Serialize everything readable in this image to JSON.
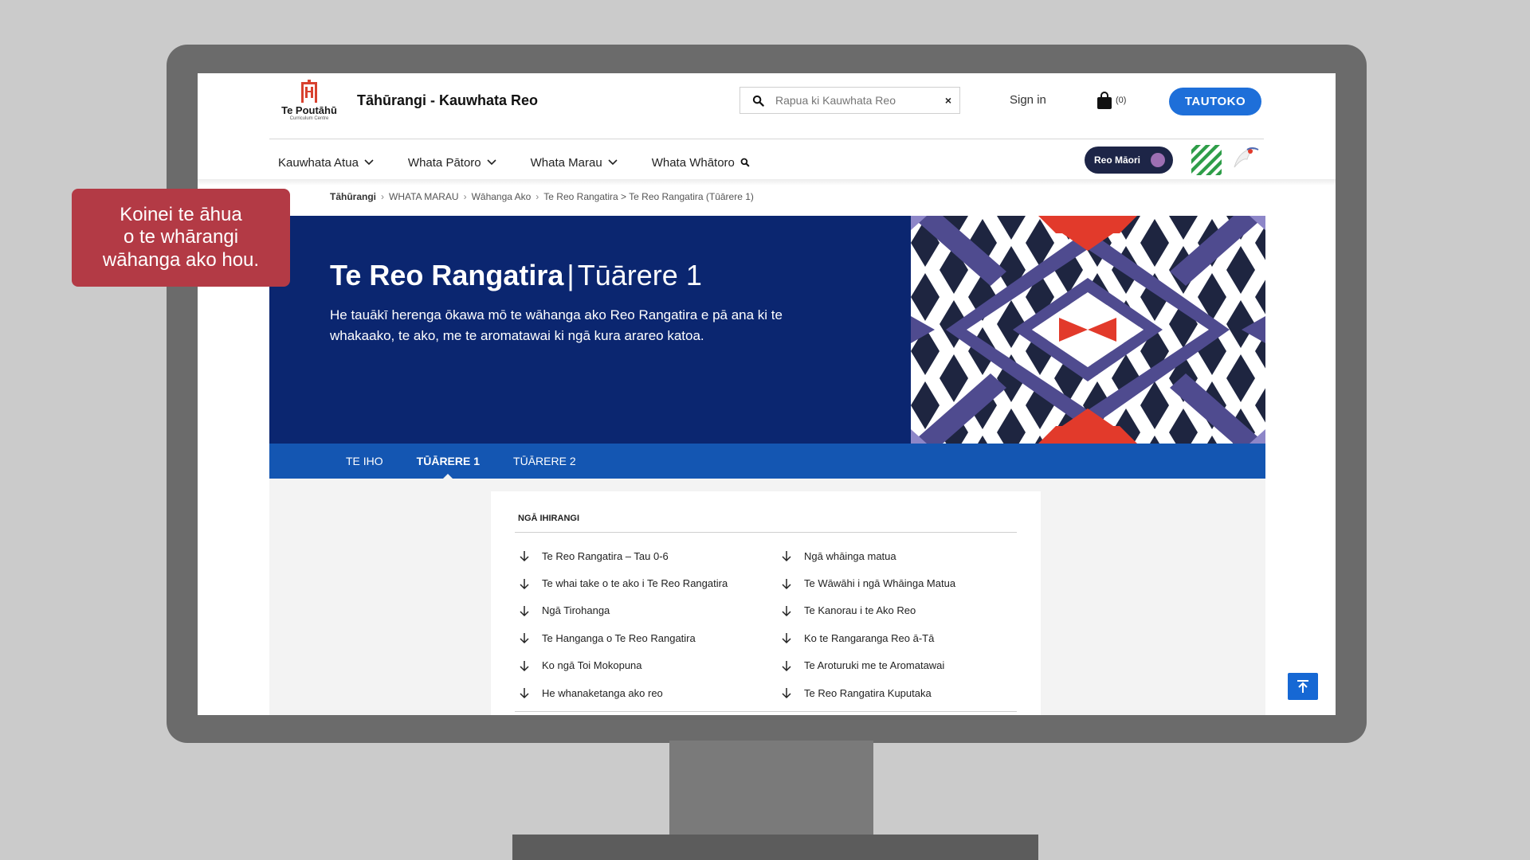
{
  "callout": {
    "lines": [
      "Koinei te āhua",
      "o te whārangi",
      "wāhanga ako hou."
    ]
  },
  "header": {
    "logo_name": "Te Poutāhū",
    "logo_sub": "Curriculum Centre",
    "site_title": "Tāhūrangi - Kauwhata Reo",
    "search_placeholder": "Rapua ki Kauwhata Reo",
    "search_clear": "×",
    "signin": "Sign in",
    "cart_count": "(0)",
    "cta": "TAUTOKO"
  },
  "nav": {
    "items": [
      "Kauwhata Atua",
      "Whata Pātoro",
      "Whata Marau",
      "Whata Whātoro"
    ],
    "language_toggle": "Reo Māori"
  },
  "breadcrumb": {
    "items": [
      "Tāhūrangi",
      "WHATA MARAU",
      "Wāhanga Ako",
      "Te Reo Rangatira > Te Reo Rangatira (Tūārere 1)"
    ]
  },
  "hero": {
    "title": "Te Reo Rangatira",
    "separator": "|",
    "subtitle": "Tūārere 1",
    "description": "He tauākī herenga ōkawa mō te wāhanga ako Reo Rangatira e pā ana ki te whakaako, te ako, me te aromatawai ki ngā kura arareo katoa."
  },
  "tabs": [
    {
      "label": "TE IHO",
      "active": false
    },
    {
      "label": "TŪĀRERE 1",
      "active": true
    },
    {
      "label": "TŪĀRERE 2",
      "active": false
    }
  ],
  "panel": {
    "heading": "NGĀ IHIRANGI",
    "left_links": [
      "Te Reo Rangatira – Tau 0-6",
      "Te whai take o te ako i Te Reo Rangatira",
      "Ngā Tirohanga",
      "Te Hanganga o Te Reo Rangatira",
      "Ko ngā Toi Mokopuna",
      "He whanaketanga ako reo"
    ],
    "right_links": [
      "Ngā whāinga matua",
      "Te Wāwāhi i ngā Whāinga Matua",
      "Te Kanorau i te Ako Reo",
      "Ko te Rangaranga Reo ā-Tā",
      "Te Aroturuki me te Aromatawai",
      "Te Reo Rangatira Kuputaka"
    ]
  },
  "colors": {
    "hero_bg": "#0b2670",
    "tab_bg": "#1456b2",
    "cta": "#1e6fd9",
    "callout": "#b33a45",
    "pattern_purple": "#4f4b8f",
    "pattern_red": "#e23a2b"
  },
  "icons": {
    "search": "search-icon",
    "cart": "shopping-bag-icon",
    "chevron": "chevron-down-icon",
    "link_arrow": "arrow-down-icon",
    "to_top": "arrow-up-to-line-icon"
  }
}
